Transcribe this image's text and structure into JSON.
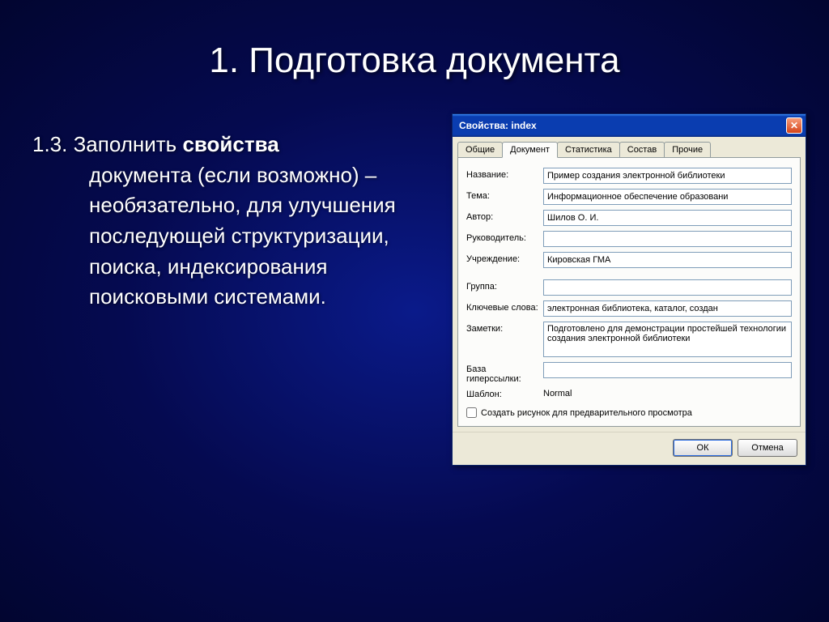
{
  "slide": {
    "title": "1. Подготовка документа",
    "body_lead": "1.3. Заполнить ",
    "body_bold": "свойства",
    "body_rest": "документа (если возможно) – необязательно, для улучшения последующей структуризации, поиска, индексирования поисковыми системами."
  },
  "dialog": {
    "title": "Свойства: index",
    "close_glyph": "✕",
    "tabs": {
      "general": "Общие",
      "document": "Документ",
      "stats": "Статистика",
      "contents": "Состав",
      "other": "Прочие"
    },
    "labels": {
      "title": "Название:",
      "subject": "Тема:",
      "author": "Автор:",
      "manager": "Руководитель:",
      "company": "Учреждение:",
      "group": "Группа:",
      "keywords": "Ключевые слова:",
      "comments": "Заметки:",
      "hyperlink_base": "База гиперссылки:",
      "template": "Шаблон:"
    },
    "values": {
      "title": "Пример создания электронной библиотеки",
      "subject": "Информационное обеспечение образовани",
      "author": "Шилов О. И.",
      "manager": "",
      "company": "Кировская ГМА",
      "group": "",
      "keywords": "электронная библиотека, каталог, создан",
      "comments": "Подготовлено для демонстрации простейшей технологии создания электронной библиотеки",
      "hyperlink_base": "",
      "template": "Normal"
    },
    "checkbox_label": "Создать рисунок для предварительного просмотра",
    "buttons": {
      "ok": "ОК",
      "cancel": "Отмена"
    }
  }
}
